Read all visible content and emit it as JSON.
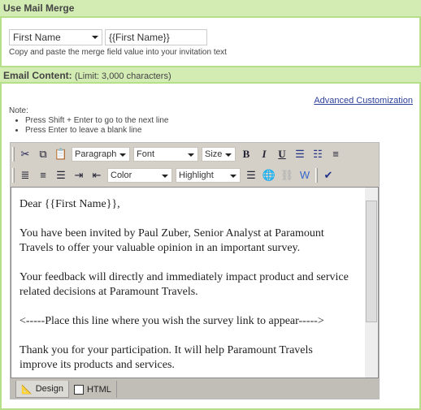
{
  "merge": {
    "title": "Use Mail Merge",
    "field_select": "First Name",
    "field_value": "{{First Name}}",
    "hint": "Copy and paste the merge field value into your invitation text"
  },
  "email": {
    "title": "Email Content:",
    "limit": "(Limit: 3,000 characters)",
    "advanced_link": "Advanced Customization",
    "note_label": "Note:",
    "notes": [
      "Press Shift + Enter to go to the next line",
      "Press Enter to leave a blank line"
    ]
  },
  "toolbar": {
    "paragraph": "Paragraph",
    "font": "Font",
    "size": "Size",
    "color": "Color",
    "highlight": "Highlight"
  },
  "body": [
    "Dear {{First Name}},",
    "You have been invited by Paul Zuber, Senior Analyst at Paramount Travels to offer your valuable opinion in an important survey.",
    "Your feedback will directly and immediately impact product and service related decisions at Paramount Travels.",
    "<-----Place this line where you wish the survey link to appear----->",
    "Thank you for your participation. It will help Paramount Travels improve its products and services."
  ],
  "tabs": [
    {
      "label": "Design",
      "active": true
    },
    {
      "label": "HTML",
      "active": false
    }
  ]
}
